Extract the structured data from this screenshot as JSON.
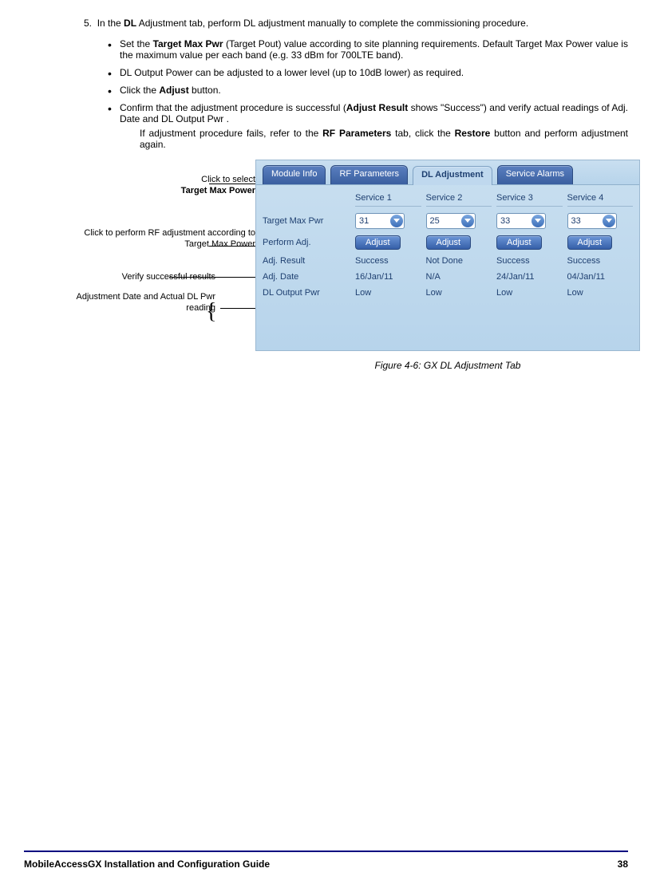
{
  "step5": {
    "number": "5.",
    "intro_prefix": "In the ",
    "intro_bold": "DL",
    "intro_suffix": " Adjustment tab, perform DL adjustment manually to complete the commissioning procedure.",
    "bullets": [
      {
        "pre": "Set the ",
        "b1": "Target Max Pwr",
        "post": " (Target Pout) value according to site planning requirements. Default Target Max Power value is the maximum value per each band (e.g. 33 dBm for 700LTE band)."
      },
      {
        "pre": "",
        "b1": "",
        "post": "DL Output Power can be adjusted to a lower level (up to 10dB lower) as required."
      },
      {
        "pre": "Click the ",
        "b1": "Adjust",
        "post": " button."
      },
      {
        "pre": "Confirm that the adjustment procedure is successful (",
        "b1": "Adjust Result",
        "post": " shows \"Success\") and verify actual readings of Adj. Date and DL Output Pwr ."
      }
    ],
    "fail_pre": "If adjustment procedure fails, refer to the ",
    "fail_b1": "RF Parameters",
    "fail_mid": " tab, click the ",
    "fail_b2": "Restore",
    "fail_post": " button and perform adjustment again."
  },
  "callouts": {
    "c1a": "Click to select",
    "c1b": "Target Max Power",
    "c2": "Click to perform RF adjustment according to Target Max Power",
    "c3": "Verify successful results",
    "c4": "Adjustment Date and Actual DL Pwr reading"
  },
  "ui": {
    "tabs": [
      "Module Info",
      "RF Parameters",
      "DL Adjustment",
      "Service Alarms"
    ],
    "active_tab": 2,
    "headers": [
      "",
      "Service 1",
      "Service 2",
      "Service 3",
      "Service 4"
    ],
    "rows": {
      "target": {
        "label": "Target Max Pwr",
        "vals": [
          "31",
          "25",
          "33",
          "33"
        ]
      },
      "perform": {
        "label": "Perform Adj.",
        "btn": "Adjust"
      },
      "result": {
        "label": "Adj. Result",
        "vals": [
          "Success",
          "Not Done",
          "Success",
          "Success"
        ]
      },
      "date": {
        "label": "Adj. Date",
        "vals": [
          "16/Jan/11",
          "N/A",
          "24/Jan/11",
          "04/Jan/11"
        ]
      },
      "output": {
        "label": "DL Output Pwr",
        "vals": [
          "Low",
          "Low",
          "Low",
          "Low"
        ]
      }
    }
  },
  "caption": "Figure 4-6: GX DL Adjustment Tab",
  "footer": {
    "title": "MobileAccessGX Installation and Configuration Guide",
    "page": "38"
  }
}
